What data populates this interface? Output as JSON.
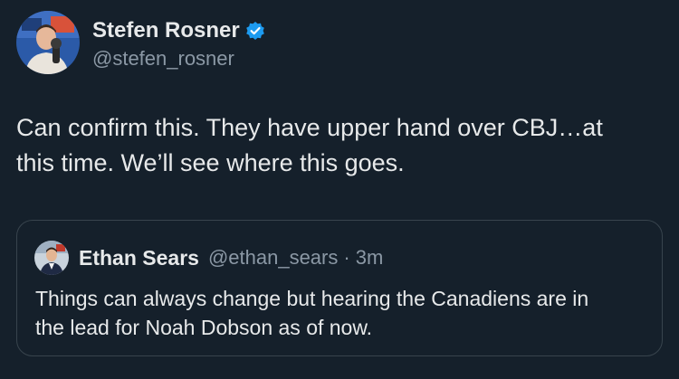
{
  "author": {
    "display_name": "Stefen Rosner",
    "handle": "@stefen_rosner",
    "verified": true,
    "avatar_icon": "person-portrait-microphone"
  },
  "tweet": {
    "text": "Can confirm this. They have upper hand over CBJ…at\nthis time. We’ll see where this goes."
  },
  "quoted_tweet": {
    "display_name": "Ethan Sears",
    "handle": "@ethan_sears",
    "separator": "·",
    "time": "3m",
    "avatar_icon": "person-portrait",
    "text": "Things can always change but hearing the Canadiens are in\nthe lead for Noah Dobson as of now."
  },
  "colors": {
    "background": "#15202b",
    "text": "#e7e9ea",
    "secondary_text": "#8b98a5",
    "verified_badge": "#1d9bf0",
    "quote_border": "#38444d"
  }
}
